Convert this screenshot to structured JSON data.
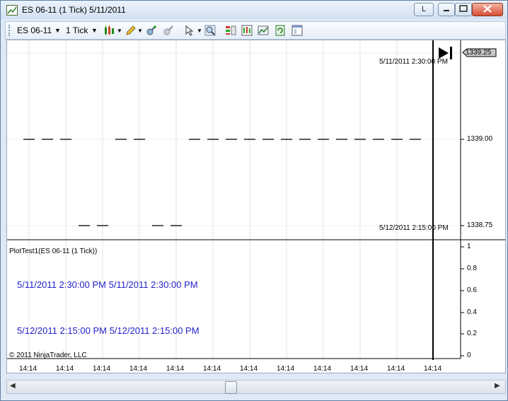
{
  "window": {
    "title": "ES 06-11 (1 Tick)  5/11/2011",
    "link_button": "L",
    "minimize": "–",
    "maximize": "□",
    "close": "✕"
  },
  "toolbar": {
    "instrument": "ES 06-11",
    "interval": "1 Tick",
    "icons": [
      "candlestick-style-icon",
      "pencil-draw-icon",
      "zoom-in-icon",
      "zoom-out-icon",
      "cursor-icon",
      "magnifier-icon",
      "data-box-icon",
      "indicators-icon",
      "strategies-icon",
      "refresh-icon",
      "properties-icon"
    ]
  },
  "chart": {
    "price_axis": [
      "1339.25",
      "1339.00",
      "1338.75"
    ],
    "current_price": "1339.25",
    "indicator_axis": [
      "1",
      "0.8",
      "0.6",
      "0.4",
      "0.2",
      "0"
    ],
    "time_labels": [
      "14:14",
      "14:14",
      "14:14",
      "14:14",
      "14:14",
      "14:14",
      "14:14",
      "14:14",
      "14:14",
      "14:14",
      "14:14",
      "14:14"
    ],
    "upper_label_top": "5/11/2011 2:30:00 PM",
    "upper_label_bottom": "5/12/2011 2:15:00 PM",
    "indicator_name": "PlotTest1(ES 06-11 (1 Tick))",
    "indicator_line1": "5/11/2011 2:30:00 PM 5/11/2011 2:30:00 PM",
    "indicator_line2": "5/12/2011 2:15:00 PM 5/12/2011 2:15:00 PM",
    "copyright": "© 2011 NinjaTrader, LLC",
    "colors": {
      "text_blue": "#1f1fcc",
      "gridline": "#e3e3e3"
    }
  }
}
